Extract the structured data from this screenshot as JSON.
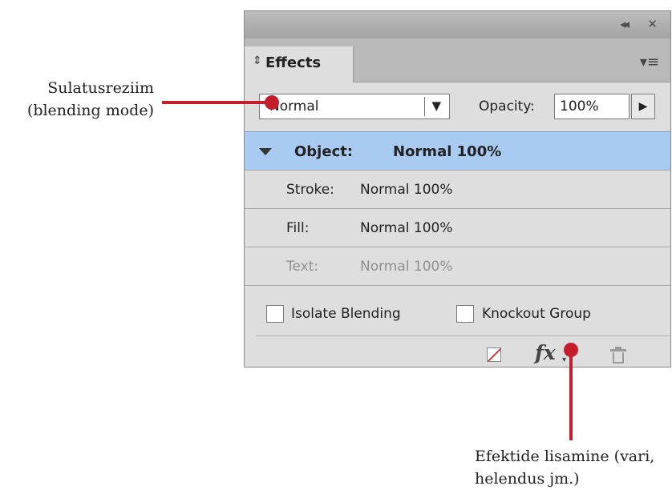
{
  "panel": {
    "title_buttons": {
      "collapse": "◂◂",
      "close": "✕"
    },
    "tab": {
      "updown": "⇕",
      "label": "Effects"
    },
    "panel_menu": "▾≡",
    "blending_mode": {
      "value": "Normal",
      "arrow": "▼"
    },
    "opacity": {
      "label": "Opacity:",
      "value": "100%",
      "arrow": "▶"
    },
    "rows": [
      {
        "label": "Object:",
        "value": "Normal 100%"
      },
      {
        "label": "Stroke:",
        "value": "Normal 100%"
      },
      {
        "label": "Fill:",
        "value": "Normal 100%"
      },
      {
        "label": "Text:",
        "value": "Normal 100%"
      }
    ],
    "checkboxes": [
      {
        "label": "Isolate Blending",
        "checked": false
      },
      {
        "label": "Knockout Group",
        "checked": false
      }
    ],
    "footer": {
      "fx_symbol": "fx",
      "fx_caret": "▾"
    },
    "colors": {
      "selected_row": "#a9cbf1",
      "panel_bg": "#dedede"
    }
  },
  "callouts": {
    "blending_mode": {
      "line1": "Sulatusreziim",
      "line2": "(blending mode)"
    },
    "add_effects": {
      "line1": "Efektide lisamine (vari,",
      "line2": "helendus jm.)"
    },
    "color": "#c41e2e"
  }
}
